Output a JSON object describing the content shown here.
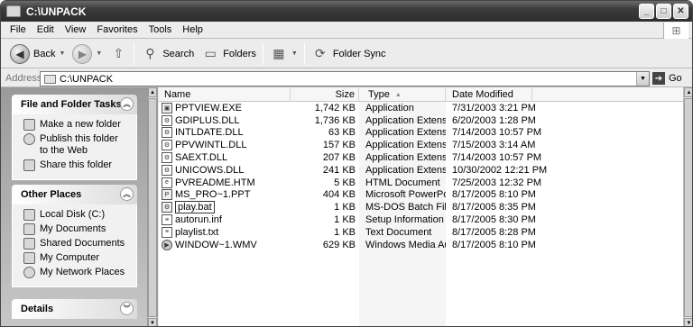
{
  "window": {
    "title": "C:\\UNPACK"
  },
  "menu": {
    "items": [
      "File",
      "Edit",
      "View",
      "Favorites",
      "Tools",
      "Help"
    ]
  },
  "toolbar": {
    "back_label": "Back",
    "search_label": "Search",
    "folders_label": "Folders",
    "folder_sync_label": "Folder Sync"
  },
  "address": {
    "label": "Address",
    "value": "C:\\UNPACK",
    "go_label": "Go"
  },
  "taskpane": {
    "file_tasks": {
      "title": "File and Folder Tasks",
      "items": [
        {
          "label": "Make a new folder",
          "icon": "new-folder-icon"
        },
        {
          "label": "Publish this folder to the Web",
          "icon": "globe-icon"
        },
        {
          "label": "Share this folder",
          "icon": "share-icon"
        }
      ]
    },
    "other_places": {
      "title": "Other Places",
      "items": [
        {
          "label": "Local Disk (C:)",
          "icon": "drive-icon"
        },
        {
          "label": "My Documents",
          "icon": "folder-icon"
        },
        {
          "label": "Shared Documents",
          "icon": "folder-icon"
        },
        {
          "label": "My Computer",
          "icon": "computer-icon"
        },
        {
          "label": "My Network Places",
          "icon": "network-icon"
        }
      ]
    },
    "details": {
      "title": "Details"
    }
  },
  "columns": {
    "name": "Name",
    "size": "Size",
    "type": "Type",
    "date": "Date Modified"
  },
  "files": [
    {
      "name": "PPTVIEW.EXE",
      "size": "1,742 KB",
      "type": "Application",
      "date": "7/31/2003 3:21 PM"
    },
    {
      "name": "GDIPLUS.DLL",
      "size": "1,736 KB",
      "type": "Application Extension",
      "date": "6/20/2003 1:28 PM"
    },
    {
      "name": "INTLDATE.DLL",
      "size": "63 KB",
      "type": "Application Extension",
      "date": "7/14/2003 10:57 PM"
    },
    {
      "name": "PPVWINTL.DLL",
      "size": "157 KB",
      "type": "Application Extension",
      "date": "7/15/2003 3:14 AM"
    },
    {
      "name": "SAEXT.DLL",
      "size": "207 KB",
      "type": "Application Extension",
      "date": "7/14/2003 10:57 PM"
    },
    {
      "name": "UNICOWS.DLL",
      "size": "241 KB",
      "type": "Application Extension",
      "date": "10/30/2002 12:21 PM"
    },
    {
      "name": "PVREADME.HTM",
      "size": "5 KB",
      "type": "HTML Document",
      "date": "7/25/2003 12:32 PM"
    },
    {
      "name": "MS_PRO~1.PPT",
      "size": "404 KB",
      "type": "Microsoft PowerPoi...",
      "date": "8/17/2005 8:10 PM"
    },
    {
      "name": "play.bat",
      "size": "1 KB",
      "type": "MS-DOS Batch File",
      "date": "8/17/2005 8:35 PM"
    },
    {
      "name": "autorun.inf",
      "size": "1 KB",
      "type": "Setup Information",
      "date": "8/17/2005 8:30 PM"
    },
    {
      "name": "playlist.txt",
      "size": "1 KB",
      "type": "Text Document",
      "date": "8/17/2005 8:28 PM"
    },
    {
      "name": "WINDOW~1.WMV",
      "size": "629 KB",
      "type": "Windows Media Aud...",
      "date": "8/17/2005 8:10 PM"
    }
  ]
}
